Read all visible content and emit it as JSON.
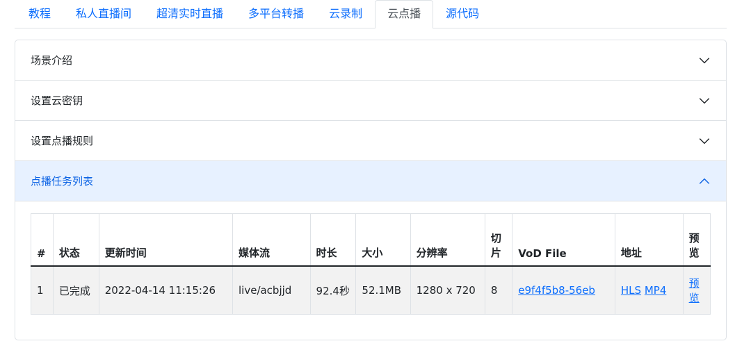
{
  "tabs": [
    {
      "label": "教程"
    },
    {
      "label": "私人直播间"
    },
    {
      "label": "超清实时直播"
    },
    {
      "label": "多平台转播"
    },
    {
      "label": "云录制"
    },
    {
      "label": "云点播",
      "active": true
    },
    {
      "label": "源代码"
    }
  ],
  "accordion": {
    "sections": [
      {
        "title": "场景介绍",
        "expanded": false
      },
      {
        "title": "设置云密钥",
        "expanded": false
      },
      {
        "title": "设置点播规则",
        "expanded": false
      },
      {
        "title": "点播任务列表",
        "expanded": true
      }
    ]
  },
  "table": {
    "headers": [
      "#",
      "状态",
      "更新时间",
      "媒体流",
      "时长",
      "大小",
      "分辨率",
      "切片",
      "VoD File",
      "地址",
      "预览"
    ],
    "rows": [
      {
        "index": "1",
        "status": "已完成",
        "updated": "2022-04-14 11:15:26",
        "stream": "live/acbjjd",
        "duration": "92.4秒",
        "size": "52.1MB",
        "resolution": "1280 x 720",
        "segments": "8",
        "vod_file": "e9f4f5b8-56eb",
        "hls": "HLS",
        "mp4": "MP4",
        "preview": "预览"
      }
    ]
  },
  "colors": {
    "link": "#0d6efd",
    "active_header_bg": "#e7f1ff",
    "active_header_text": "#0c63e4"
  }
}
